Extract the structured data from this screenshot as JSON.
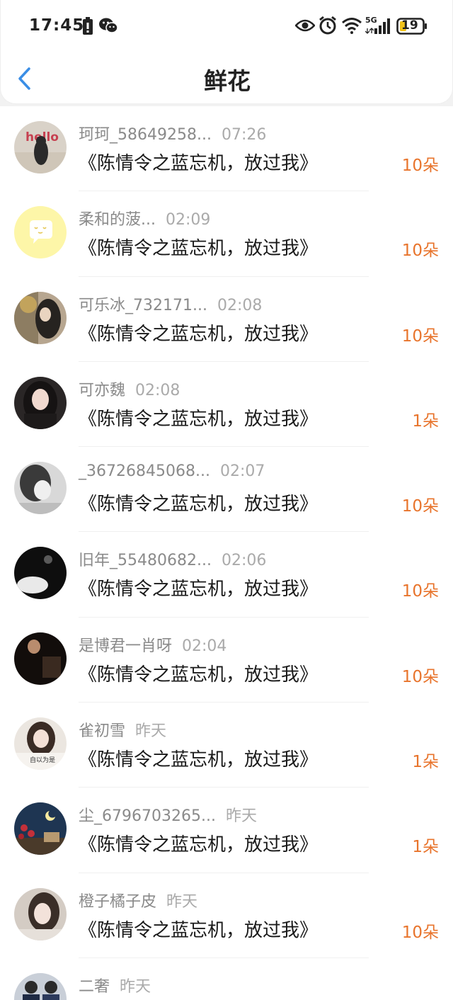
{
  "status_bar": {
    "time": "17:45",
    "network": "5G",
    "battery": "19"
  },
  "header": {
    "title": "鲜花"
  },
  "colors": {
    "accent_blue": "#3a8ee6",
    "count_orange": "#e8742c"
  },
  "rows": [
    {
      "name": "珂珂_58649258...",
      "time": "07:26",
      "book": "《陈情令之蓝忘机，放过我》",
      "count": "10朵"
    },
    {
      "name": "柔和的菠...",
      "time": "02:09",
      "book": "《陈情令之蓝忘机，放过我》",
      "count": "10朵"
    },
    {
      "name": "可乐冰_732171...",
      "time": "02:08",
      "book": "《陈情令之蓝忘机，放过我》",
      "count": "10朵"
    },
    {
      "name": "可亦魏",
      "time": "02:08",
      "book": "《陈情令之蓝忘机，放过我》",
      "count": "1朵"
    },
    {
      "name": "_36726845068...",
      "time": "02:07",
      "book": "《陈情令之蓝忘机，放过我》",
      "count": "10朵"
    },
    {
      "name": "旧年_55480682...",
      "time": "02:06",
      "book": "《陈情令之蓝忘机，放过我》",
      "count": "10朵"
    },
    {
      "name": "是博君一肖呀",
      "time": "02:04",
      "book": "《陈情令之蓝忘机，放过我》",
      "count": "10朵"
    },
    {
      "name": "雀初雪",
      "time": "昨天",
      "book": "《陈情令之蓝忘机，放过我》",
      "count": "1朵"
    },
    {
      "name": "尘_6796703265...",
      "time": "昨天",
      "book": "《陈情令之蓝忘机，放过我》",
      "count": "1朵"
    },
    {
      "name": "橙子橘子皮",
      "time": "昨天",
      "book": "《陈情令之蓝忘机，放过我》",
      "count": "10朵"
    },
    {
      "name": "二奢",
      "time": "昨天",
      "book": "",
      "count": ""
    }
  ],
  "avatar_texts": {
    "hello": "hello",
    "caption": "自以为是"
  }
}
